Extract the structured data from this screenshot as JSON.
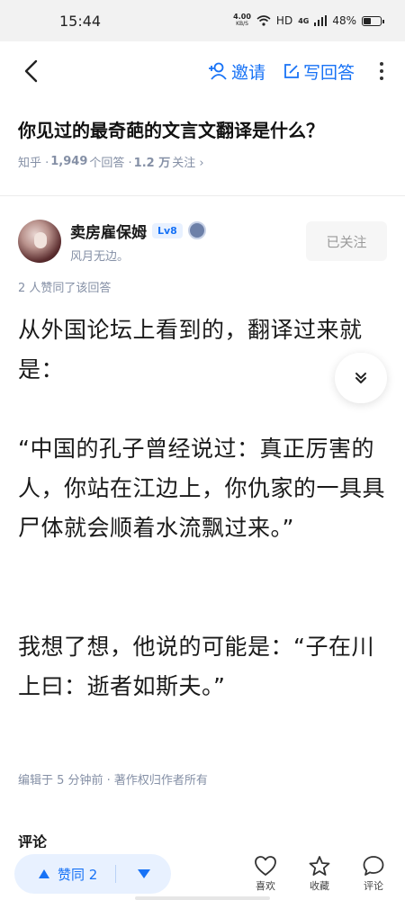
{
  "status_bar": {
    "time": "15:44",
    "net_speed_value": "4.00",
    "net_speed_unit": "KB/S",
    "network": "HD",
    "signal": "4G",
    "battery": "48%",
    "battery_level": 0.48
  },
  "nav": {
    "back_icon": "back-arrow-icon",
    "invite_label": "邀请",
    "write_answer_label": "写回答",
    "accent_color": "#1772f6"
  },
  "question": {
    "title": "你见过的最奇葩的文言文翻译是什么？",
    "source": "知乎 · ",
    "answer_count": "1,949",
    "answer_suffix": " 个回答 · ",
    "follow_count": "1.2 万",
    "follow_suffix": "关注 ›"
  },
  "author": {
    "name": "卖房雇保姆",
    "level": "Lv8",
    "bio": "风月无边。",
    "follow_label": "已关注"
  },
  "answer": {
    "upvote_note": "2 人赞同了该回答",
    "paragraphs": [
      "从外国论坛上看到的，翻译过来就是：",
      "“中国的孔子曾经说过：真正厉害的人，你站在江边上，你仇家的一具具尸体就会顺着水流飘过来。”",
      "我想了想，他说的可能是：“子在川上曰：逝者如斯夫。”"
    ],
    "edit_note": "编辑于 5 分钟前 · 著作权归作者所有"
  },
  "comments": {
    "heading": "评论"
  },
  "bottom_bar": {
    "upvote_label": "赞同 2",
    "like_label": "喜欢",
    "collect_label": "收藏",
    "comment_label": "评论"
  }
}
